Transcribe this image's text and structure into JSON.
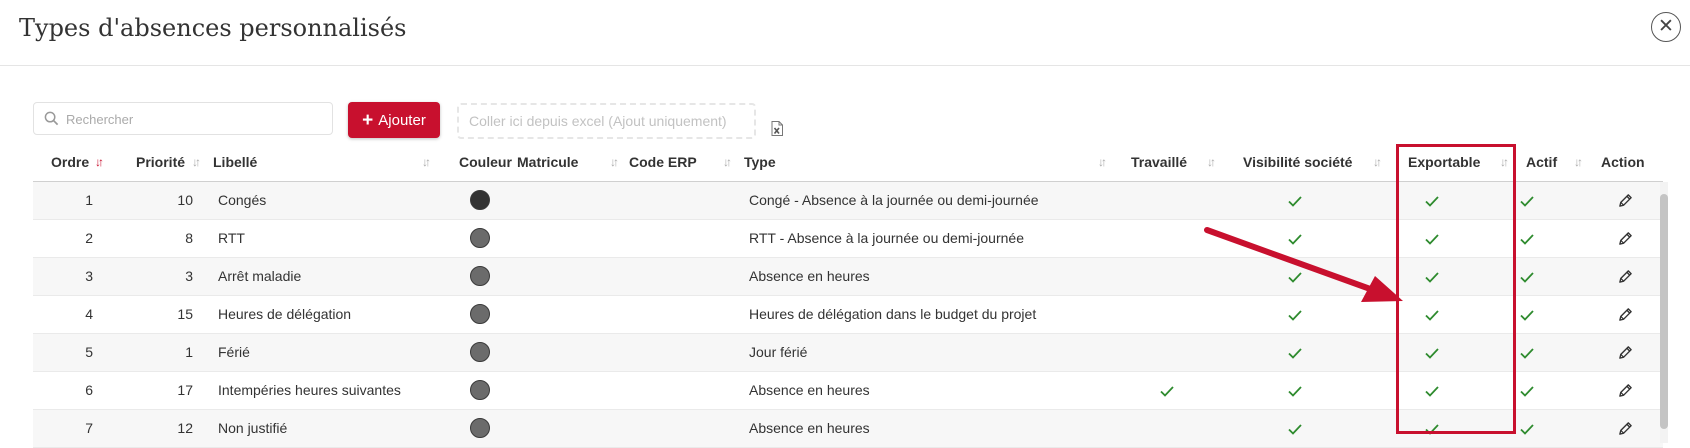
{
  "dialog": {
    "title": "Types d'absences personnalisés",
    "close_icon": "close-icon"
  },
  "toolbar": {
    "search_placeholder": "Rechercher",
    "add_label": "Ajouter",
    "paste_placeholder": "Coller ici depuis excel (Ajout uniquement)",
    "excel_icon": "excel-file-icon"
  },
  "colors": {
    "accent": "#c8102e",
    "check": "#2e8b2e",
    "default_dot": "#6b6b6b",
    "conges_dot": "#333333"
  },
  "table": {
    "headers": {
      "ordre": "Ordre",
      "priorite": "Priorité",
      "libelle": "Libellé",
      "couleur": "Couleur",
      "matricule": "Matricule",
      "code_erp": "Code ERP",
      "type": "Type",
      "travaille": "Travaillé",
      "visibilite": "Visibilité société",
      "exportable": "Exportable",
      "actif": "Actif",
      "action": "Action"
    },
    "rows": [
      {
        "ordre": "1",
        "priorite": "10",
        "libelle": "Congés",
        "type": "Congé - Absence à la journée ou demi-journée",
        "color": "#333333",
        "travaille": false,
        "visibilite": true,
        "exportable": true,
        "actif": true
      },
      {
        "ordre": "2",
        "priorite": "8",
        "libelle": "RTT",
        "type": "RTT - Absence à la journée ou demi-journée",
        "color": "#6b6b6b",
        "travaille": false,
        "visibilite": true,
        "exportable": true,
        "actif": true
      },
      {
        "ordre": "3",
        "priorite": "3",
        "libelle": "Arrêt maladie",
        "type": "Absence en heures",
        "color": "#6b6b6b",
        "travaille": false,
        "visibilite": true,
        "exportable": true,
        "actif": true
      },
      {
        "ordre": "4",
        "priorite": "15",
        "libelle": "Heures de délégation",
        "type": "Heures de délégation dans le budget du projet",
        "color": "#6b6b6b",
        "travaille": false,
        "visibilite": true,
        "exportable": true,
        "actif": true
      },
      {
        "ordre": "5",
        "priorite": "1",
        "libelle": "Férié",
        "type": "Jour férié",
        "color": "#6b6b6b",
        "travaille": false,
        "visibilite": true,
        "exportable": true,
        "actif": true
      },
      {
        "ordre": "6",
        "priorite": "17",
        "libelle": "Intempéries heures suivantes",
        "type": "Absence en heures",
        "color": "#6b6b6b",
        "travaille": true,
        "visibilite": true,
        "exportable": true,
        "actif": true
      },
      {
        "ordre": "7",
        "priorite": "12",
        "libelle": "Non justifié",
        "type": "Absence en heures",
        "color": "#6b6b6b",
        "travaille": false,
        "visibilite": true,
        "exportable": true,
        "actif": true
      }
    ]
  }
}
